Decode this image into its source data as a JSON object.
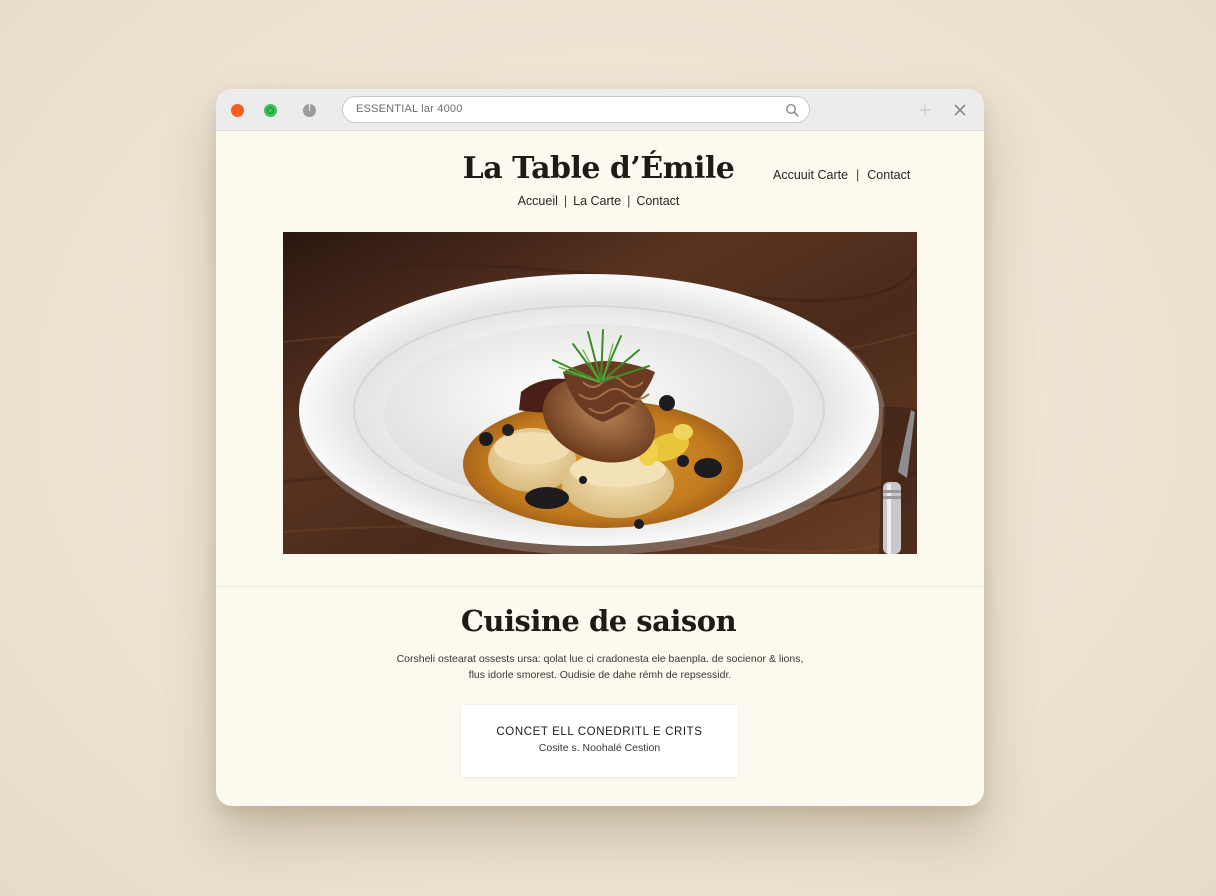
{
  "browser": {
    "url": "ESSENTIAL lar 4000"
  },
  "site": {
    "title": "La Table d’Émile",
    "nav_center": [
      "Accueil",
      "La Carte",
      "Contact"
    ],
    "nav_center_separator": "|",
    "nav_right": [
      "Accuuit Carte",
      "Contact"
    ],
    "nav_right_separator": "|"
  },
  "hero": {
    "image": "plated-dish-photo"
  },
  "section": {
    "title": "Cuisine de saison",
    "text_line1": "Corsheli ostearat ossests ursa: qolat lue ci cradonesta ele baenpla. de socienor & lions,",
    "text_line2": "flus idorle smorest. Oudisie de dahe rémh de repsessidr."
  },
  "cta": {
    "title": "CONCET ELL CONEDRITL E CRITS",
    "subtitle": "Cosite s. Noohalé Cestion"
  },
  "colors": {
    "page_bg": "#ece3d2",
    "window_bg": "#fcf9ee",
    "close_dot": "#f2611f",
    "min_dot": "#3cc15a",
    "info_dot": "#9a9a9a",
    "text_dark": "#1e1b17"
  }
}
